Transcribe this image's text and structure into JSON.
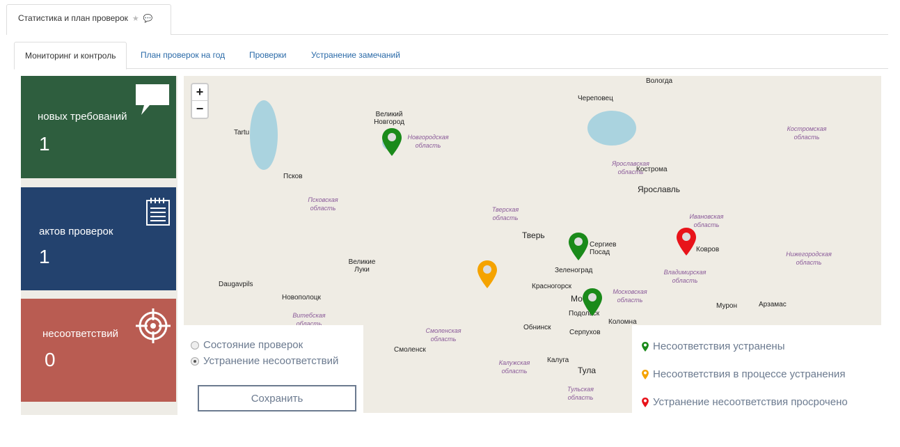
{
  "page_tab": {
    "title": "Статистика и план проверок"
  },
  "tabs": [
    {
      "label": "Мониторинг и контроль"
    },
    {
      "label": "План проверок на год"
    },
    {
      "label": "Проверки"
    },
    {
      "label": "Устранение замечаний"
    }
  ],
  "cards": [
    {
      "label": "новых требований",
      "value": "1",
      "color": "#2e5e3e"
    },
    {
      "label": "актов проверок",
      "value": "1",
      "color": "#23426e"
    },
    {
      "label": "несоответствий",
      "value": "0",
      "color": "#b95c52"
    }
  ],
  "map": {
    "zoom_in": "+",
    "zoom_out": "−",
    "cities": [
      "Вологда",
      "Череповец",
      "Великий Новгород",
      "Tartu",
      "Псков",
      "Кострома",
      "Ярославль",
      "Тверь",
      "Сергиев Посад",
      "Ковров",
      "Великие Луки",
      "Зеленоград",
      "Красногорск",
      "Москва",
      "Daugavpils",
      "Новополоцк",
      "Подольск",
      "Коломна",
      "Мурон",
      "Арзамас",
      "Обнинск",
      "Серпухов",
      "Смоленск",
      "Калуга",
      "Тула"
    ],
    "regions": [
      "Новгородская область",
      "Псковская область",
      "Тверская область",
      "Ярославская область",
      "Костромская область",
      "Ивановская область",
      "Владимирская область",
      "Нижегородская область",
      "Московская область",
      "Смоленская область",
      "Калужская область",
      "Тульская область",
      "Витебская область"
    ]
  },
  "controls": {
    "radio_1": "Состояние проверок",
    "radio_2": "Устранение несоответствий",
    "save": "Сохранить"
  },
  "legend": [
    {
      "label": "Несоответствия устранены",
      "color": "#1a8a1a"
    },
    {
      "label": "Несоответствия в процессе устранения",
      "color": "#f5a300"
    },
    {
      "label": "Устранение несоответствия просрочено",
      "color": "#e8131a"
    }
  ]
}
